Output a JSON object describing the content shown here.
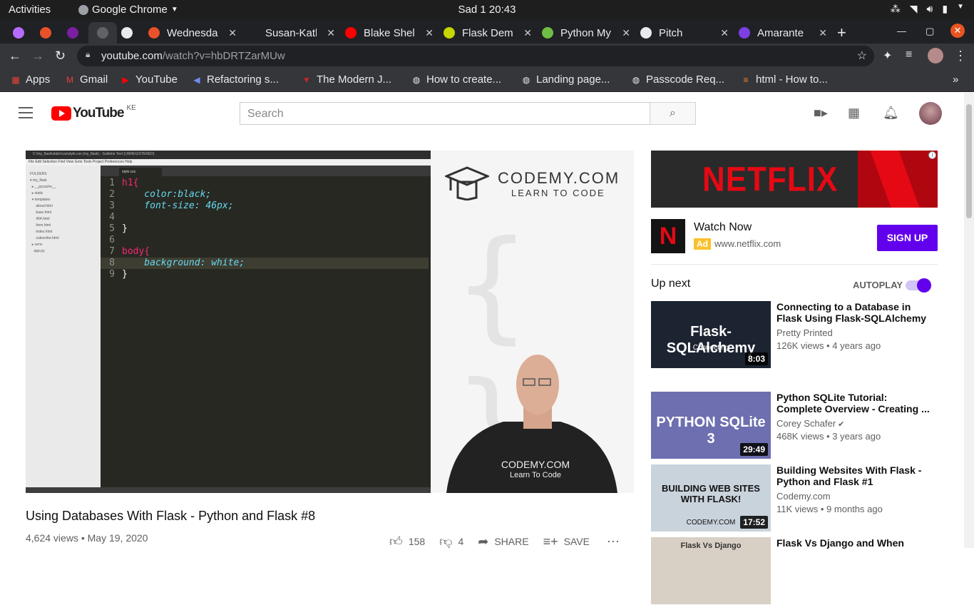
{
  "system": {
    "activities": "Activities",
    "app_name": "Google Chrome",
    "clock": "Sad 1  20:43"
  },
  "tabs": [
    {
      "label": "",
      "color": "#b66bff"
    },
    {
      "label": "",
      "color": "#e8512a"
    },
    {
      "label": "",
      "color": "#7a1fa2"
    },
    {
      "label": "",
      "color": "#5f6368"
    },
    {
      "label": "",
      "color": "#e8eaed"
    },
    {
      "label": "Wednesda",
      "color": "#e8512a"
    },
    {
      "label": "Susan-Kath",
      "color": "#202124"
    },
    {
      "label": "Blake Shel",
      "color": "#ff0000"
    },
    {
      "label": "Flask Dem",
      "color": "#c5d600"
    },
    {
      "label": "Python My",
      "color": "#6ebd44"
    },
    {
      "label": "Pitch",
      "color": "#e8eaed"
    },
    {
      "label": "Amarante",
      "color": "#7b3fe4"
    }
  ],
  "address": {
    "host": "youtube.com",
    "path": "/watch?v=hbDRTZarMUw"
  },
  "bookmarks": [
    {
      "label": "Apps",
      "icon": "apps-icon"
    },
    {
      "label": "Gmail",
      "icon": "gmail-icon"
    },
    {
      "label": "YouTube",
      "icon": "youtube-icon"
    },
    {
      "label": "Refactoring s...",
      "icon": "vscode-icon"
    },
    {
      "label": "The Modern J...",
      "icon": "js-icon"
    },
    {
      "label": "How to create...",
      "icon": "globe-icon"
    },
    {
      "label": "Landing page...",
      "icon": "globe-icon"
    },
    {
      "label": "Passcode Req...",
      "icon": "globe-icon"
    },
    {
      "label": "html - How to...",
      "icon": "stackoverflow-icon"
    }
  ],
  "youtube": {
    "region": "KE",
    "search_placeholder": "Search",
    "video": {
      "title": "Using Databases With Flask - Python and Flask #8",
      "views": "4,624 views",
      "date": "May 19, 2020",
      "likes": "158",
      "dislikes": "4",
      "share": "SHARE",
      "save": "SAVE"
    },
    "player": {
      "brand_big": "CODEMY.COM",
      "brand_small": "LEARN TO CODE",
      "shirt_line1": "CODEMY.COM",
      "shirt_line2": "Learn To Code",
      "editor_title": "C:\\my_flask\\static\\css\\style.css (my_flask) - Sublime Text (UNREGISTERED)",
      "editor_menu": "File  Edit  Selection  Find  View  Goto  Tools  Project  Preferences  Help",
      "editor_tab": "style.css",
      "sidebar": [
        "FOLDERS",
        "▾ my_flask",
        "  ▸ __pycache__",
        "  ▸ static",
        "  ▾ templates",
        "      about.html",
        "      base.html",
        "      404.html",
        "      form.html",
        "      index.html",
        "      subscribe.html",
        "  ▸ venv",
        "    app.py"
      ],
      "code": [
        {
          "n": "1",
          "t": "h1{"
        },
        {
          "n": "2",
          "t": "    color:black;"
        },
        {
          "n": "3",
          "t": "    font-size: 46px;"
        },
        {
          "n": "4",
          "t": ""
        },
        {
          "n": "5",
          "t": "}"
        },
        {
          "n": "6",
          "t": ""
        },
        {
          "n": "7",
          "t": "body{"
        },
        {
          "n": "8",
          "t": "    background: white;"
        },
        {
          "n": "9",
          "t": "}"
        }
      ]
    },
    "ad": {
      "banner": "NETFLIX",
      "logo": "N",
      "watch_now": "Watch Now",
      "badge": "Ad",
      "url": "www.netflix.com",
      "cta": "SIGN UP"
    },
    "up_next": "Up next",
    "autoplay": "AUTOPLAY",
    "autoplay_on": true,
    "related": [
      {
        "title": "Connecting to a Database in Flask Using Flask-SQLAlchemy",
        "channel": "Pretty Printed",
        "meta": "126K views • 4 years ago",
        "duration": "8:03",
        "thumb_title": "Flask-SQLAlchemy",
        "thumb_sub": "Connecting",
        "thumb_bg": "#1c2431"
      },
      {
        "title": "Python SQLite Tutorial: Complete Overview - Creating ...",
        "channel": "Corey Schafer",
        "meta": "468K views • 3 years ago",
        "duration": "29:49",
        "thumb_title": "PYTHON  SQLite 3",
        "thumb_sub": "",
        "thumb_bg": "#6d6fb0",
        "verified": true
      },
      {
        "title": "Building Websites With Flask - Python and Flask #1",
        "channel": "Codemy.com",
        "meta": "11K views • 9 months ago",
        "duration": "17:52",
        "thumb_title": "BUILDING WEB SITES WITH FLASK!",
        "thumb_sub": "CODEMY.COM",
        "thumb_bg": "#c9d3dc"
      },
      {
        "title": "Flask Vs Django and When",
        "channel": "",
        "meta": "",
        "duration": "",
        "thumb_title": "Flask Vs Django",
        "thumb_sub": "",
        "thumb_bg": "#d8d0c4"
      }
    ]
  }
}
